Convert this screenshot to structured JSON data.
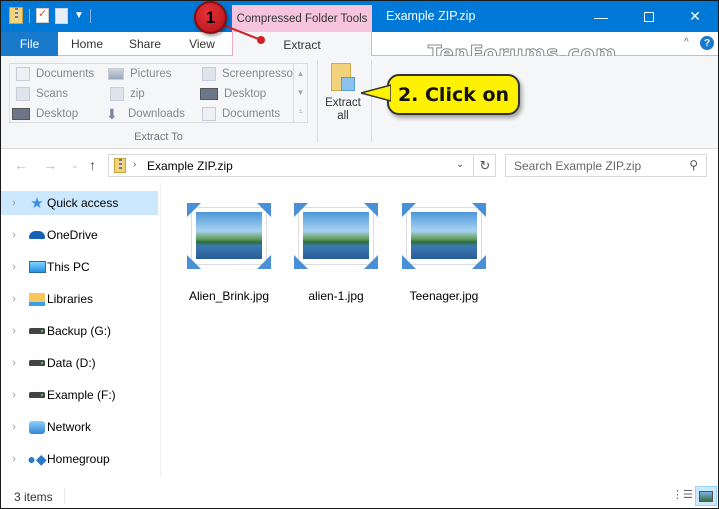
{
  "window": {
    "title": "Example ZIP.zip",
    "contextual_tab_header": "Compressed Folder Tools",
    "minimize_glyph": "—",
    "close_glyph": "✕",
    "watermark": "TenForums.com"
  },
  "ribbon": {
    "tabs": [
      {
        "label": "File"
      },
      {
        "label": "Home"
      },
      {
        "label": "Share"
      },
      {
        "label": "View"
      },
      {
        "label": "Extract"
      }
    ],
    "collapse_glyph": "^",
    "help_glyph": "?",
    "extract_to": {
      "group_label": "Extract To",
      "items": [
        {
          "label": "Documents",
          "icon": "documents-icon"
        },
        {
          "label": "Pictures",
          "icon": "pictures-icon"
        },
        {
          "label": "Screenpresso",
          "icon": "folder-icon"
        },
        {
          "label": "Scans",
          "icon": "folder-icon"
        },
        {
          "label": "zip",
          "icon": "folder-icon"
        },
        {
          "label": "Desktop",
          "icon": "desktop-icon"
        },
        {
          "label": "Desktop",
          "icon": "desktop-icon"
        },
        {
          "label": "Downloads",
          "icon": "downloads-icon"
        },
        {
          "label": "Documents",
          "icon": "documents-icon"
        }
      ],
      "scroll_glyphs": [
        "▲",
        "▼",
        "⩡"
      ]
    },
    "extract_all": {
      "label_line1": "Extract",
      "label_line2": "all"
    }
  },
  "annotations": {
    "step1": "1",
    "step2": "2. Click on"
  },
  "navigation": {
    "back_glyph": "←",
    "forward_glyph": "→",
    "recent_glyph": "⌄",
    "up_glyph": "↑",
    "address": {
      "separator": "›",
      "path": "Example ZIP.zip",
      "dropdown_glyph": "⌄",
      "refresh_glyph": "↻"
    },
    "search": {
      "placeholder": "Search Example ZIP.zip",
      "icon_glyph": "⚲"
    }
  },
  "sidebar": {
    "items": [
      {
        "label": "Quick access",
        "icon": "quick-access-icon",
        "selected": true
      },
      {
        "label": "OneDrive",
        "icon": "onedrive-icon"
      },
      {
        "label": "This PC",
        "icon": "this-pc-icon"
      },
      {
        "label": "Libraries",
        "icon": "libraries-icon"
      },
      {
        "label": "Backup (G:)",
        "icon": "drive-icon"
      },
      {
        "label": "Data (D:)",
        "icon": "drive-icon"
      },
      {
        "label": "Example (F:)",
        "icon": "drive-icon"
      },
      {
        "label": "Network",
        "icon": "network-icon"
      },
      {
        "label": "Homegroup",
        "icon": "homegroup-icon"
      }
    ],
    "chevron_glyph": "›"
  },
  "files": [
    {
      "name": "Alien_Brink.jpg"
    },
    {
      "name": "alien-1.jpg"
    },
    {
      "name": "Teenager.jpg"
    }
  ],
  "status": {
    "item_count": "3 items"
  },
  "colors": {
    "titlebar": "#0078d7",
    "file_tab": "#1979ca",
    "contextual_tab": "#f7c4dd",
    "selection": "#cce8ff",
    "callout_yellow": "#fff200",
    "callout_red": "#d41f26"
  }
}
